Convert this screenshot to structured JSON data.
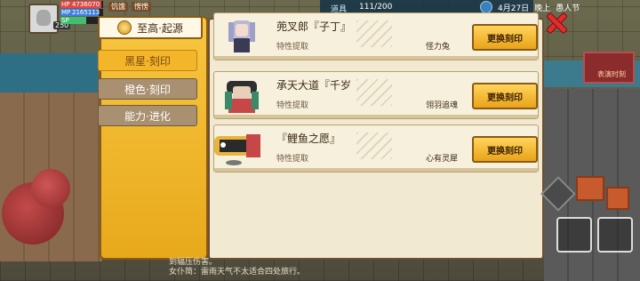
{
  "hud": {
    "level": "250",
    "bars": [
      {
        "label": "HP",
        "value": "4736070",
        "color": "#e04646",
        "fill": 0.95
      },
      {
        "label": "MP",
        "value": "2165113",
        "color": "#3f7fe0",
        "fill": 0.9
      },
      {
        "label": "SP",
        "value": "",
        "color": "#3fbf6f",
        "fill": 0.6
      }
    ],
    "tags": [
      "饥饿",
      "愣愣"
    ],
    "items_label": "道具",
    "items_count": "111/200",
    "date": "4月27日",
    "time": "晚上",
    "festival": "愚人节"
  },
  "map": {
    "fire_label": "表演时刻"
  },
  "tabs": [
    {
      "label": "至高·起源",
      "active": true
    },
    {
      "label": "黑星·刻印",
      "active": false
    },
    {
      "label": "橙色·刻印",
      "active": false
    },
    {
      "label": "能力·进化",
      "active": false
    }
  ],
  "cards": [
    {
      "title": "蔸叉郎『子丁』",
      "sub": "特性提取",
      "skill": "怪力兔",
      "button": "更换刻印"
    },
    {
      "title": "承天大道『千岁",
      "sub": "特性提取",
      "skill": "翎羽追魂",
      "button": "更换刻印"
    },
    {
      "title": "『鲤鱼之愿』",
      "sub": "特性提取",
      "skill": "心有灵犀",
      "button": "更换刻印"
    }
  ],
  "log": [
    "到辐压伤害。",
    "女仆简：雷雨天气不太适合四处旅行。"
  ],
  "colors": {
    "accent": "#f3b52a",
    "panel": "#f2e9d2",
    "close": "#e32d2d"
  }
}
